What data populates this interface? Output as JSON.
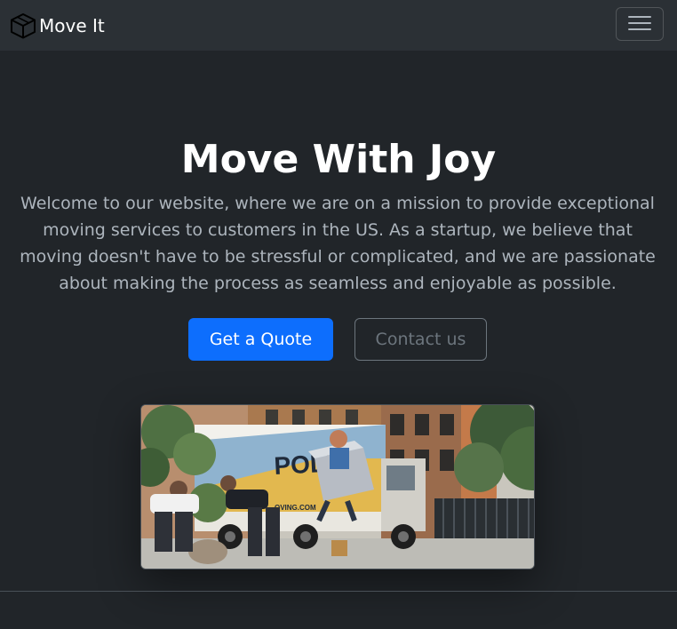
{
  "navbar": {
    "brand_label": "Move It",
    "brand_icon": "box-icon",
    "toggler_icon": "hamburger-menu-icon"
  },
  "hero": {
    "title": "Move With Joy",
    "lead": "Welcome to our website, where we are on a mission to provide exceptional moving services to customers in the US. As a startup, we believe that moving doesn't have to be stressful or complicated, and we are passionate about making the process as seamless and enjoyable as possible.",
    "primary_button": "Get a Quote",
    "secondary_button": "Contact us",
    "image_truck_text": "POLIS",
    "image_truck_subtext": "OVING.COM"
  },
  "colors": {
    "background": "#212529",
    "navbar": "#2b3035",
    "primary": "#0d6efd",
    "secondary": "#6c757d"
  }
}
